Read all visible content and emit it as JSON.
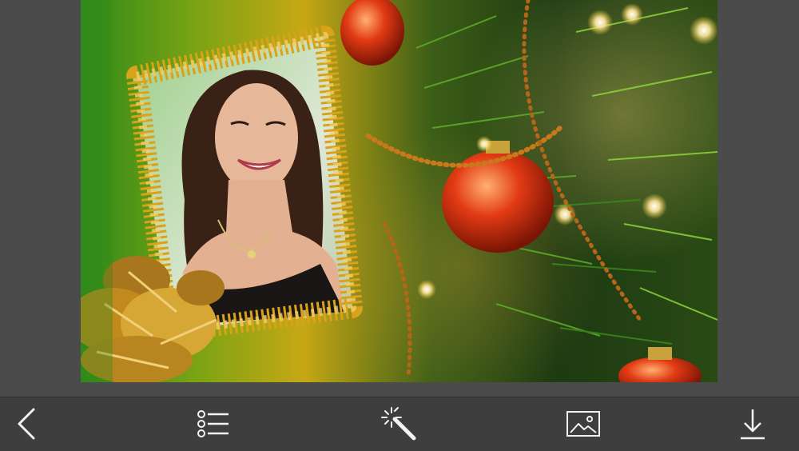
{
  "editor": {
    "frame_theme": "christmas-tree-gold-beads",
    "colors": {
      "background": "#4b4b4b",
      "toolbar": "#3e3e3e",
      "icon": "#f2f2f2",
      "bead_gold": "#d8a21a",
      "ornament_red": "#e23b14",
      "tree_green": "#3f8e1e"
    }
  },
  "toolbar": {
    "items": [
      {
        "name": "back",
        "icon": "chevron-left-icon"
      },
      {
        "name": "frames-list",
        "icon": "list-icon"
      },
      {
        "name": "effects",
        "icon": "magic-wand-icon"
      },
      {
        "name": "gallery",
        "icon": "image-icon"
      },
      {
        "name": "save",
        "icon": "download-icon"
      }
    ]
  }
}
